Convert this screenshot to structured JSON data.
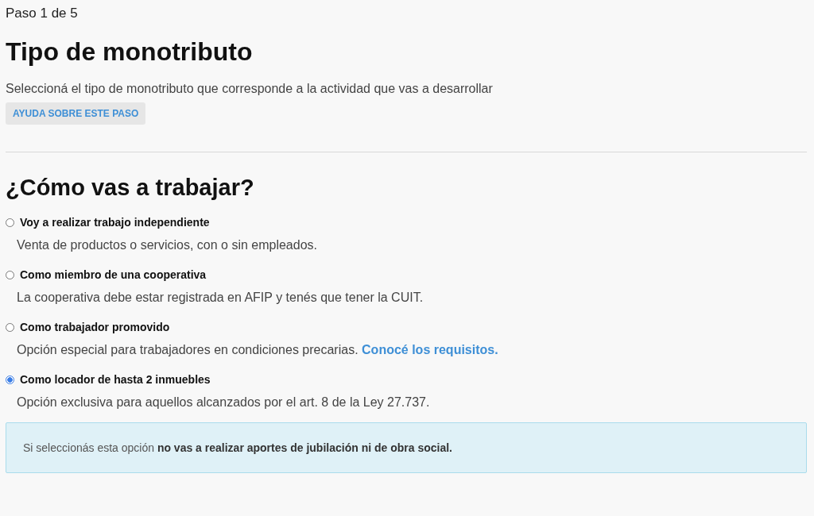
{
  "step": "Paso 1 de 5",
  "title": "Tipo de monotributo",
  "subtitle": "Seleccioná el tipo de monotributo que corresponde a la actividad que vas a desarrollar",
  "help_button": "AYUDA SOBRE ESTE PASO",
  "question": "¿Cómo vas a trabajar?",
  "options": [
    {
      "label": "Voy a realizar trabajo independiente",
      "description": "Venta de productos o servicios, con o sin empleados.",
      "selected": false
    },
    {
      "label": "Como miembro de una cooperativa",
      "description": "La cooperativa debe estar registrada en AFIP y tenés que tener la CUIT.",
      "selected": false
    },
    {
      "label": "Como trabajador promovido",
      "description": "Opción especial para trabajadores en condiciones precarias.",
      "link": "Conocé los requisitos.",
      "selected": false
    },
    {
      "label": "Como locador de hasta 2 inmuebles",
      "description": "Opción exclusiva para aquellos alcanzados por el art. 8 de la Ley 27.737.",
      "selected": true
    }
  ],
  "alert": "Si seleccionás esta opción **no vas a realizar aportes de jubilación ni de obra social.**"
}
